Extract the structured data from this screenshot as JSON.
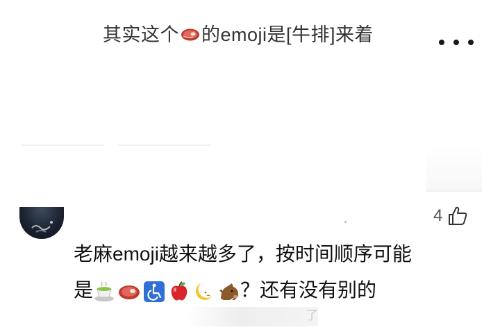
{
  "post": {
    "title_part1": "其实这个",
    "title_part2": "的emoji是[牛排]来着",
    "title_emoji": "steak-icon"
  },
  "comment": {
    "like_count": "4",
    "line1": "老麻emoji越来越多了，按时间顺序可能",
    "line2_prefix": "是",
    "emojis": [
      "tea-icon",
      "steak-icon",
      "wheelchair-icon",
      "apple-icon",
      "crescent-moon-icon",
      "boar-icon"
    ],
    "line2_suffix": "？还有没有别的"
  },
  "footer": {
    "faded_text": "了"
  }
}
